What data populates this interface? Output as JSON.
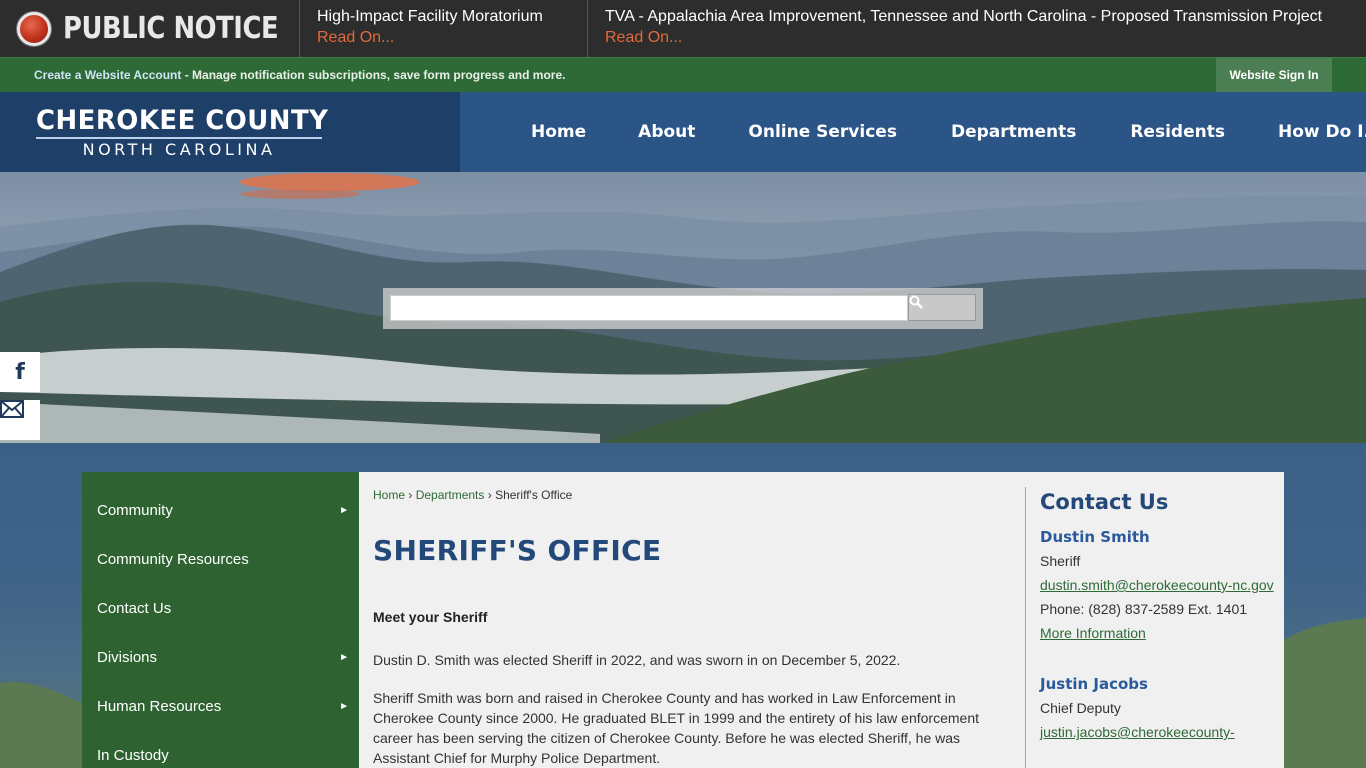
{
  "notice_bar": {
    "title": "PUBLIC NOTICE",
    "items": [
      {
        "title": "High-Impact Facility Moratorium",
        "link": "Read On..."
      },
      {
        "title": "TVA - Appalachia Area Improvement, Tennessee and North Carolina - Proposed Transmission Project",
        "link": "Read On..."
      }
    ]
  },
  "account_bar": {
    "create_link": "Create a Website Account",
    "description": " - Manage notification subscriptions, save form progress and more.",
    "signin": "Website Sign In"
  },
  "header": {
    "logo_main": "CHEROKEE COUNTY",
    "logo_sub": "NORTH CAROLINA",
    "nav": [
      "Home",
      "About",
      "Online Services",
      "Departments",
      "Residents",
      "How Do I..."
    ]
  },
  "hero": {
    "search_placeholder": "",
    "social": [
      "facebook-icon",
      "email-icon"
    ]
  },
  "sidebar": {
    "items": [
      {
        "label": "Community",
        "arrow": "►"
      },
      {
        "label": "Community Resources",
        "arrow": ""
      },
      {
        "label": "Contact Us",
        "arrow": ""
      },
      {
        "label": "Divisions",
        "arrow": "►"
      },
      {
        "label": "Human Resources",
        "arrow": "►"
      },
      {
        "label": "In Custody",
        "arrow": ""
      }
    ]
  },
  "content": {
    "breadcrumb": {
      "home": "Home",
      "sep": " › ",
      "departments": "Departments",
      "current": "Sheriff's Office"
    },
    "title": "SHERIFF'S OFFICE",
    "meet": "Meet your Sheriff",
    "para1": "Dustin D. Smith was elected Sheriff in 2022, and was sworn in on December 5, 2022.",
    "para2": "Sheriff Smith was born and raised in Cherokee County and has worked in Law Enforcement in Cherokee County since 2000. He graduated BLET in 1999 and the entirety of his law enforcement career has been serving the citizen of Cherokee County. Before he was elected Sheriff, he was Assistant Chief for Murphy Police Department."
  },
  "contact": {
    "heading": "Contact Us",
    "people": [
      {
        "name": "Dustin Smith",
        "title": "Sheriff",
        "email": "dustin.smith@cherokeecounty-nc.gov",
        "phone": "Phone: (828) 837-2589 Ext. 1401",
        "more": "More Information"
      },
      {
        "name": "Justin Jacobs",
        "title": "Chief Deputy",
        "email": "justin.jacobs@cherokeecounty-"
      }
    ]
  },
  "colors": {
    "notice_bg": "#2d2d2d",
    "notice_link": "#e06a3a",
    "account_green": "#2e6a36",
    "header_blue": "#2b5487",
    "title_blue": "#23487a",
    "sidebar_green": "#2e6331"
  }
}
